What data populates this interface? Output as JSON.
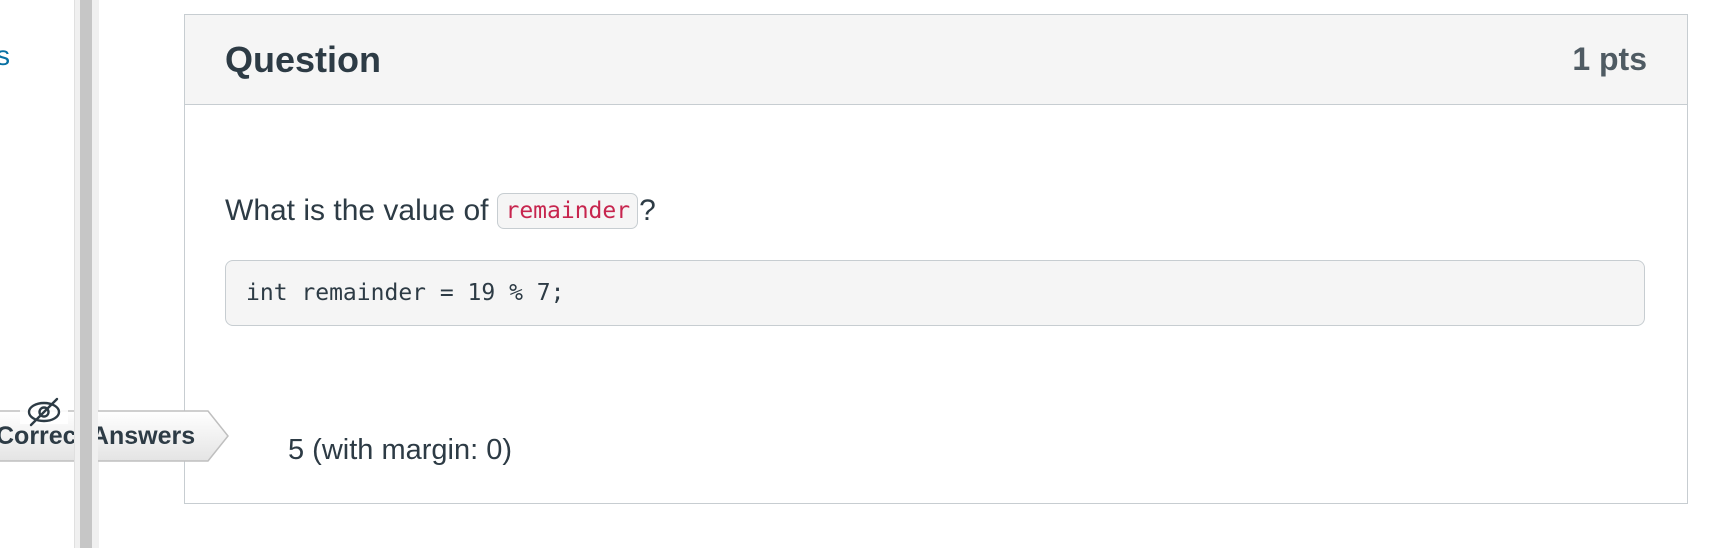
{
  "sidebar": {
    "link_fragment": "s"
  },
  "question": {
    "title": "Question",
    "points": "1 pts",
    "prompt_before": "What is the value of",
    "prompt_code": "remainder",
    "prompt_after": "?",
    "code": "int remainder = 19 % 7;",
    "answer": "5 (with margin: 0)"
  },
  "correct_answers_tag": {
    "label": "Correct Answers",
    "icon": "eye-slash-icon"
  },
  "colors": {
    "link": "#0770a3",
    "code_text": "#c7254e",
    "header_bg": "#f5f5f5",
    "text": "#2d3b45"
  }
}
